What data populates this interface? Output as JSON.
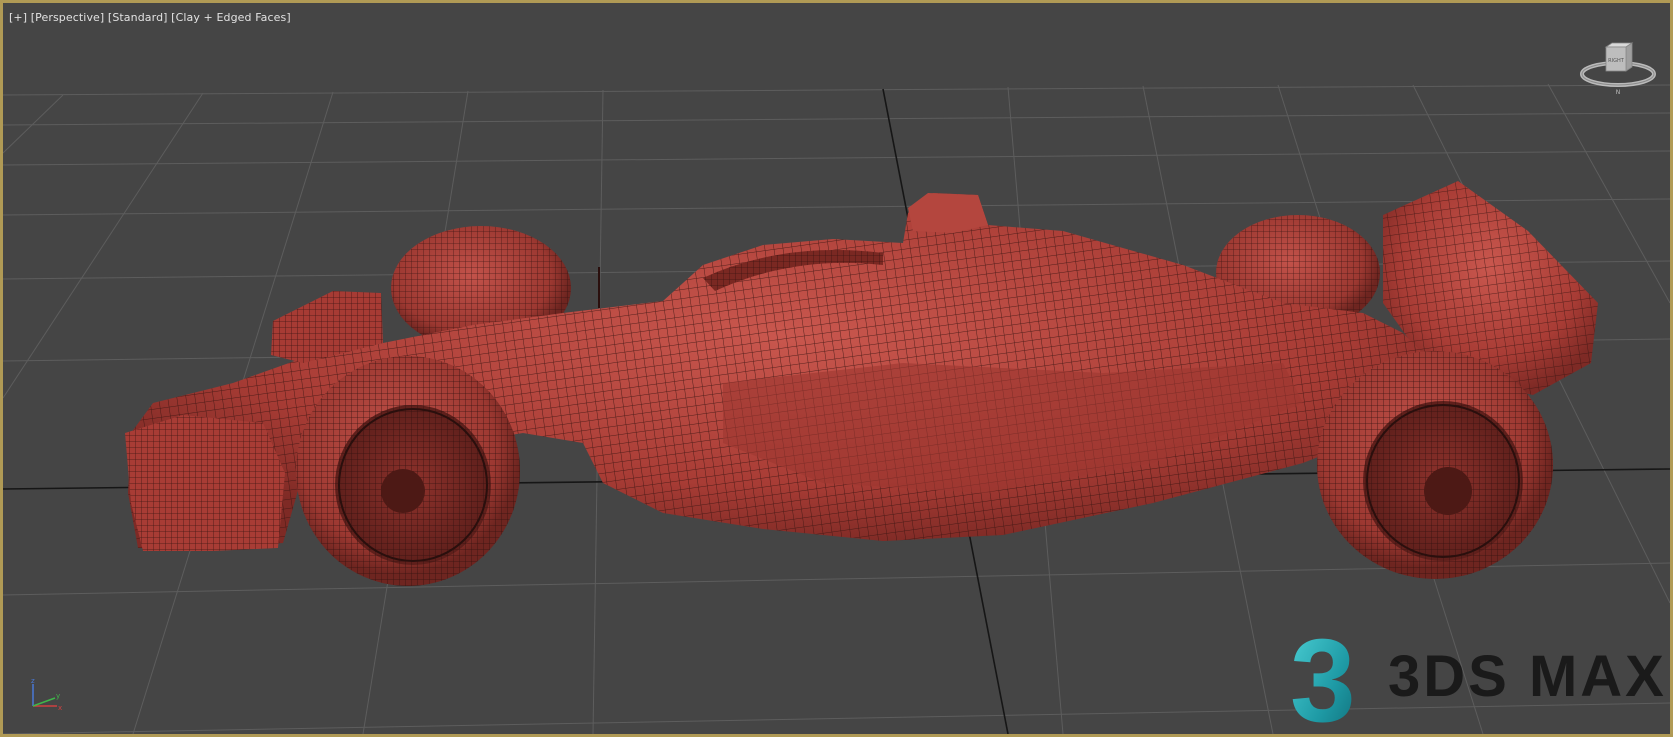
{
  "viewport": {
    "menu_label": "[+]",
    "view_label": "[Perspective]",
    "shading_label": "[Standard]",
    "display_label": "[Clay + Edged Faces]",
    "border_color": "#b09a55",
    "background_color": "#454545"
  },
  "viewcube": {
    "face_label": "RIGHT",
    "compass_letter": "N"
  },
  "axis_tripod": {
    "x": "x",
    "y": "y",
    "z": "z"
  },
  "model": {
    "material_color": "#b8443c",
    "wire_color": "#3a1512"
  },
  "logo": {
    "glyph": "3",
    "text": "3DS MAX",
    "glyph_color": "#2aa9b4"
  }
}
